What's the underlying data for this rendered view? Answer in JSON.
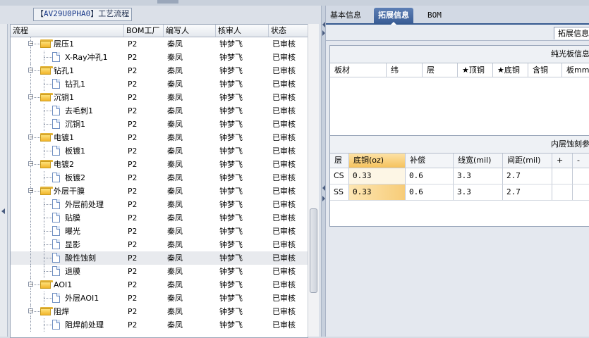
{
  "group_box": {
    "prefix": "【",
    "code": "AV29U0PHA0",
    "suffix": "】",
    "label": "工艺流程"
  },
  "tree_grid": {
    "columns": [
      "流程",
      "BOM工厂",
      "编写人",
      "核审人",
      "状态"
    ],
    "rows": [
      {
        "label": "层压1",
        "type": "folder",
        "level": 0,
        "bom": "P2",
        "writer": "秦凤",
        "reviewer": "钟梦飞",
        "status": "已审核"
      },
      {
        "label": "X-Ray冲孔1",
        "type": "doc",
        "level": 1,
        "bom": "P2",
        "writer": "秦凤",
        "reviewer": "钟梦飞",
        "status": "已审核"
      },
      {
        "label": "钻孔1",
        "type": "folder",
        "level": 0,
        "bom": "P2",
        "writer": "秦凤",
        "reviewer": "钟梦飞",
        "status": "已审核"
      },
      {
        "label": "钻孔1",
        "type": "doc",
        "level": 1,
        "bom": "P2",
        "writer": "秦凤",
        "reviewer": "钟梦飞",
        "status": "已审核"
      },
      {
        "label": "沉铜1",
        "type": "folder",
        "level": 0,
        "bom": "P2",
        "writer": "秦凤",
        "reviewer": "钟梦飞",
        "status": "已审核"
      },
      {
        "label": "去毛刺1",
        "type": "doc",
        "level": 1,
        "bom": "P2",
        "writer": "秦凤",
        "reviewer": "钟梦飞",
        "status": "已审核"
      },
      {
        "label": "沉铜1",
        "type": "doc",
        "level": 1,
        "bom": "P2",
        "writer": "秦凤",
        "reviewer": "钟梦飞",
        "status": "已审核"
      },
      {
        "label": "电镀1",
        "type": "folder",
        "level": 0,
        "bom": "P2",
        "writer": "秦凤",
        "reviewer": "钟梦飞",
        "status": "已审核"
      },
      {
        "label": "板镀1",
        "type": "doc",
        "level": 1,
        "bom": "P2",
        "writer": "秦凤",
        "reviewer": "钟梦飞",
        "status": "已审核"
      },
      {
        "label": "电镀2",
        "type": "folder",
        "level": 0,
        "bom": "P2",
        "writer": "秦凤",
        "reviewer": "钟梦飞",
        "status": "已审核"
      },
      {
        "label": "板镀2",
        "type": "doc",
        "level": 1,
        "bom": "P2",
        "writer": "秦凤",
        "reviewer": "钟梦飞",
        "status": "已审核"
      },
      {
        "label": "外层干膜",
        "type": "folder",
        "level": 0,
        "bom": "P2",
        "writer": "秦凤",
        "reviewer": "钟梦飞",
        "status": "已审核"
      },
      {
        "label": "外层前处理",
        "type": "doc",
        "level": 1,
        "bom": "P2",
        "writer": "秦凤",
        "reviewer": "钟梦飞",
        "status": "已审核"
      },
      {
        "label": "贴膜",
        "type": "doc",
        "level": 1,
        "bom": "P2",
        "writer": "秦凤",
        "reviewer": "钟梦飞",
        "status": "已审核"
      },
      {
        "label": "曝光",
        "type": "doc",
        "level": 1,
        "bom": "P2",
        "writer": "秦凤",
        "reviewer": "钟梦飞",
        "status": "已审核"
      },
      {
        "label": "显影",
        "type": "doc",
        "level": 1,
        "bom": "P2",
        "writer": "秦凤",
        "reviewer": "钟梦飞",
        "status": "已审核"
      },
      {
        "label": "酸性蚀刻",
        "type": "doc",
        "level": 1,
        "bom": "P2",
        "writer": "秦凤",
        "reviewer": "钟梦飞",
        "status": "已审核",
        "selected": true
      },
      {
        "label": "退膜",
        "type": "doc",
        "level": 1,
        "bom": "P2",
        "writer": "秦凤",
        "reviewer": "钟梦飞",
        "status": "已审核"
      },
      {
        "label": "AOI1",
        "type": "folder",
        "level": 0,
        "bom": "P2",
        "writer": "秦凤",
        "reviewer": "钟梦飞",
        "status": "已审核"
      },
      {
        "label": "外层AOI1",
        "type": "doc",
        "level": 1,
        "bom": "P2",
        "writer": "秦凤",
        "reviewer": "钟梦飞",
        "status": "已审核"
      },
      {
        "label": "阻焊",
        "type": "folder",
        "level": 0,
        "bom": "P2",
        "writer": "秦凤",
        "reviewer": "钟梦飞",
        "status": "已审核"
      },
      {
        "label": "阻焊前处理",
        "type": "doc",
        "level": 1,
        "bom": "P2",
        "writer": "秦凤",
        "reviewer": "钟梦飞",
        "status": "已审核"
      }
    ]
  },
  "tabs": [
    "基本信息",
    "拓展信息",
    "BOM"
  ],
  "active_tab": 1,
  "subtab": "拓展信息",
  "panel1": {
    "title": "纯光板信息",
    "columns": [
      "板材",
      "纬",
      "层",
      "★顶铜",
      "★底铜",
      "含铜",
      "板mm"
    ]
  },
  "panel2": {
    "title": "内层蚀刻参数",
    "columns": [
      "层",
      "底铜(oz)",
      "补偿",
      "线宽(mil)",
      "间距(mil)",
      "+",
      "-"
    ],
    "rows": [
      {
        "layer": "CS",
        "base_cu": "0.33",
        "comp": "0.6",
        "width": "3.3",
        "spacing": "2.7"
      },
      {
        "layer": "SS",
        "base_cu": "0.33",
        "comp": "0.6",
        "width": "3.3",
        "spacing": "2.7"
      }
    ]
  },
  "colors": {
    "accent": "#3a5d96",
    "highlight": "#f5c25c",
    "folder": "#f1b52b"
  }
}
